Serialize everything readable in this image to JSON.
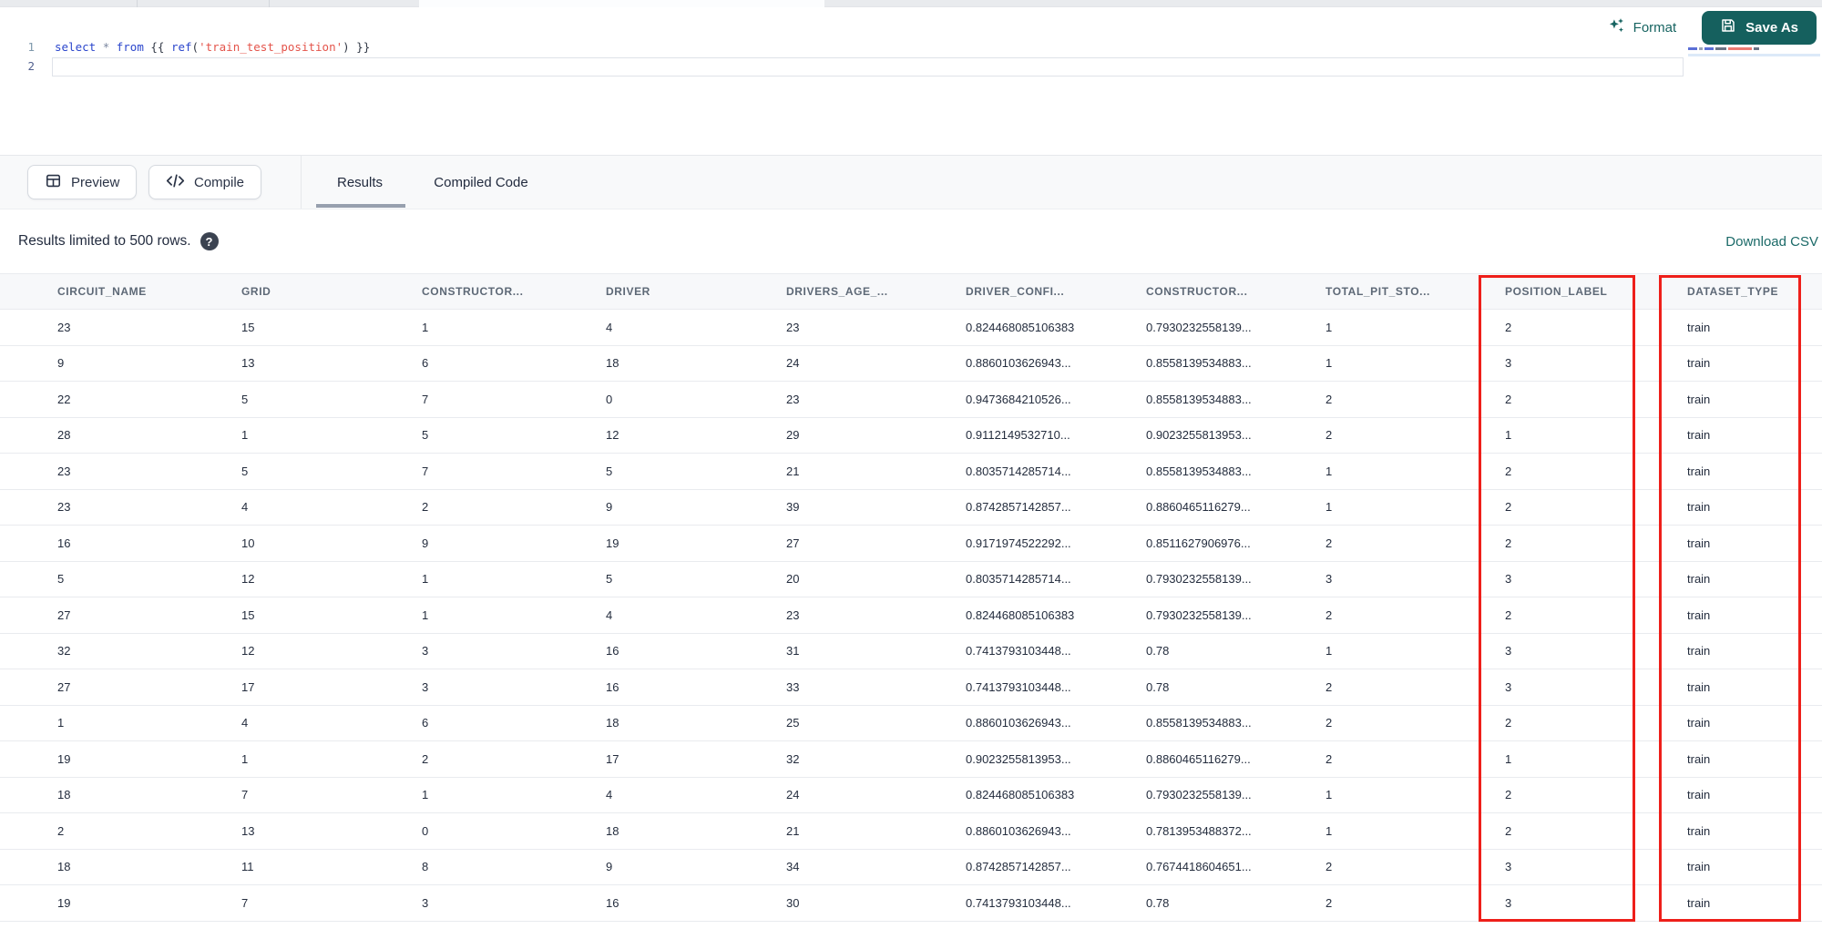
{
  "editor": {
    "lines": [
      {
        "number": "1"
      },
      {
        "number": "2"
      }
    ],
    "code": "select * from {{ ref('train_test_position') }}",
    "tokens": [
      {
        "t": "select",
        "c": "kw"
      },
      {
        "t": " ",
        "c": "pl"
      },
      {
        "t": "*",
        "c": "op"
      },
      {
        "t": " ",
        "c": "pl"
      },
      {
        "t": "from",
        "c": "kw"
      },
      {
        "t": " {{ ",
        "c": "pl"
      },
      {
        "t": "ref",
        "c": "kw"
      },
      {
        "t": "(",
        "c": "pl"
      },
      {
        "t": "'train_test_position'",
        "c": "str"
      },
      {
        "t": ")",
        "c": "pl"
      },
      {
        "t": " }}",
        "c": "pl"
      }
    ]
  },
  "editor_toolbar": {
    "format": "Format",
    "save_as": "Save As"
  },
  "action_bar": {
    "preview": "Preview",
    "compile": "Compile"
  },
  "result_tabs": [
    {
      "label": "Results",
      "active": true
    },
    {
      "label": "Compiled Code",
      "active": false
    }
  ],
  "results_bar": {
    "message": "Results limited to 500 rows.",
    "help_glyph": "?",
    "download": "Download CSV"
  },
  "table": {
    "columns": [
      "CIRCUIT_NAME",
      "GRID",
      "CONSTRUCTOR...",
      "DRIVER",
      "DRIVERS_AGE_...",
      "DRIVER_CONFI...",
      "CONSTRUCTOR...",
      "TOTAL_PIT_STO...",
      "POSITION_LABEL",
      "DATASET_TYPE"
    ],
    "rows": [
      [
        "23",
        "15",
        "1",
        "4",
        "23",
        "0.824468085106383",
        "0.7930232558139...",
        "1",
        "2",
        "train"
      ],
      [
        "9",
        "13",
        "6",
        "18",
        "24",
        "0.8860103626943...",
        "0.8558139534883...",
        "1",
        "3",
        "train"
      ],
      [
        "22",
        "5",
        "7",
        "0",
        "23",
        "0.9473684210526...",
        "0.8558139534883...",
        "2",
        "2",
        "train"
      ],
      [
        "28",
        "1",
        "5",
        "12",
        "29",
        "0.9112149532710...",
        "0.9023255813953...",
        "2",
        "1",
        "train"
      ],
      [
        "23",
        "5",
        "7",
        "5",
        "21",
        "0.8035714285714...",
        "0.8558139534883...",
        "1",
        "2",
        "train"
      ],
      [
        "23",
        "4",
        "2",
        "9",
        "39",
        "0.8742857142857...",
        "0.8860465116279...",
        "1",
        "2",
        "train"
      ],
      [
        "16",
        "10",
        "9",
        "19",
        "27",
        "0.9171974522292...",
        "0.8511627906976...",
        "2",
        "2",
        "train"
      ],
      [
        "5",
        "12",
        "1",
        "5",
        "20",
        "0.8035714285714...",
        "0.7930232558139...",
        "3",
        "3",
        "train"
      ],
      [
        "27",
        "15",
        "1",
        "4",
        "23",
        "0.824468085106383",
        "0.7930232558139...",
        "2",
        "2",
        "train"
      ],
      [
        "32",
        "12",
        "3",
        "16",
        "31",
        "0.7413793103448...",
        "0.78",
        "1",
        "3",
        "train"
      ],
      [
        "27",
        "17",
        "3",
        "16",
        "33",
        "0.7413793103448...",
        "0.78",
        "2",
        "3",
        "train"
      ],
      [
        "1",
        "4",
        "6",
        "18",
        "25",
        "0.8860103626943...",
        "0.8558139534883...",
        "2",
        "2",
        "train"
      ],
      [
        "19",
        "1",
        "2",
        "17",
        "32",
        "0.9023255813953...",
        "0.8860465116279...",
        "2",
        "1",
        "train"
      ],
      [
        "18",
        "7",
        "1",
        "4",
        "24",
        "0.824468085106383",
        "0.7930232558139...",
        "1",
        "2",
        "train"
      ],
      [
        "2",
        "13",
        "0",
        "18",
        "21",
        "0.8860103626943...",
        "0.7813953488372...",
        "1",
        "2",
        "train"
      ],
      [
        "18",
        "11",
        "8",
        "9",
        "34",
        "0.8742857142857...",
        "0.7674418604651...",
        "2",
        "3",
        "train"
      ],
      [
        "19",
        "7",
        "3",
        "16",
        "30",
        "0.7413793103448...",
        "0.78",
        "2",
        "3",
        "train"
      ]
    ]
  },
  "annotations": {
    "highlight_color": "#ee1f1a",
    "highlighted_columns": [
      "POSITION_LABEL",
      "DATASET_TYPE"
    ]
  },
  "colors": {
    "accent_teal": "#15605e",
    "link_teal": "#1b6a68",
    "header_text": "#5d6876",
    "cell_text": "#242d3e",
    "annotation_red": "#ee1f1a",
    "keyword_blue": "#2b46cc",
    "string_red": "#e4544b"
  }
}
